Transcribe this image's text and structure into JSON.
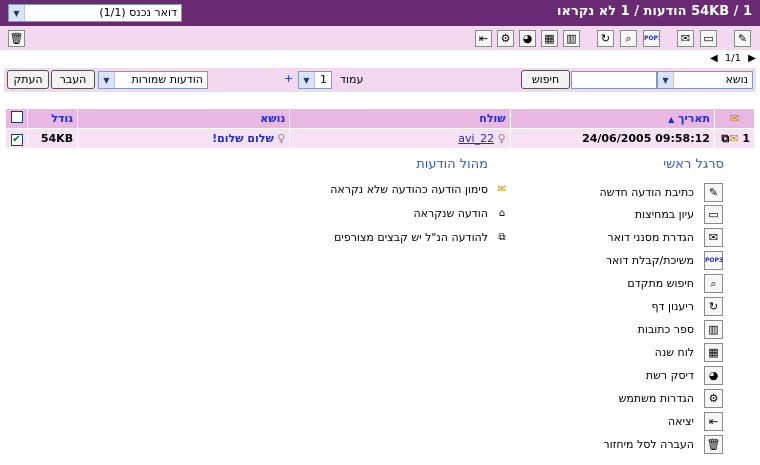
{
  "title_bar": {
    "title": "54KB / 1 הודעות / 1 לא נקראו",
    "folder_select": "דואר נכנס (1/1)"
  },
  "toolbar": {
    "icons": [
      "new-message-icon",
      "folders-icon",
      "mail-filters-icon",
      "pop3-icon",
      "advanced-search-icon",
      "refresh-icon",
      "address-book-icon",
      "calendar-icon",
      "network-disk-icon",
      "user-settings-icon",
      "logout-icon"
    ],
    "trash_icon": "recycle-bin-icon"
  },
  "pager": {
    "text": "1/1"
  },
  "filter_bar": {
    "search_field_select": "נושא",
    "search_button": "חיפוש",
    "page_label": "עמוד",
    "page_value": "1",
    "plus": "+",
    "move_target_select": "הודעות שמורות",
    "move_button": "העבר",
    "copy_button": "העתק"
  },
  "table": {
    "headers": {
      "date": "תאריך",
      "sort_arrow": "▲",
      "from": "שולח",
      "subject": "נושא",
      "size": "גודל"
    },
    "rows": [
      {
        "index": "1",
        "date": "24/06/2005 09:58:12",
        "from": "avi_22",
        "subject": "שלום שלום!",
        "size": "54KB",
        "checked": "✔"
      }
    ]
  },
  "main_menu": {
    "title": "סרגל ראשי",
    "items": [
      "כתיבת הודעה חדשה",
      "עיון במחיצות",
      "הגדרת מסנני דואר",
      "משיכת/קבלת דואר",
      "חיפוש מתקדם",
      "ריענון דף",
      "ספר כתובות",
      "לוח שנה",
      "דיסק רשת",
      "הגדרות משתמש",
      "יציאה",
      "העברה לסל מיחזור"
    ]
  },
  "legend": {
    "title": "מהול הודעות",
    "items": [
      "סימון הודעה כהודעה שלא נקראה",
      "הודעה שנקראה",
      "להודעה הנ\"ל יש קבצים מצורפים"
    ]
  },
  "colors": {
    "title_bar": "#6a2a73",
    "toolbar": "#f3d9ef",
    "header": "#e9b7e3",
    "row": "#f7e2f4",
    "link": "#1f2ed1"
  }
}
